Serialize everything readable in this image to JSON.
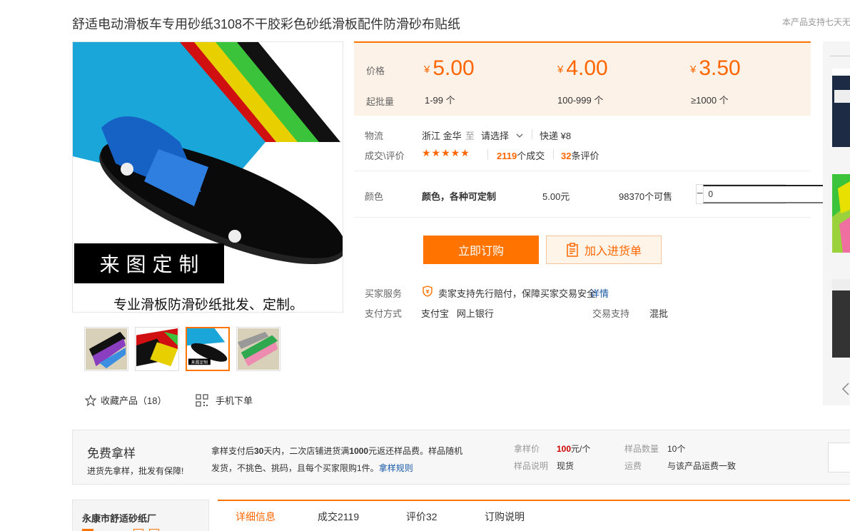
{
  "product": {
    "title": "舒适电动滑板车专用砂纸3108不干胶彩色砂纸滑板配件防滑砂布贴纸",
    "notice": "本产品支持七天无"
  },
  "gallery": {
    "banner_text": "来 图 定 制",
    "caption": "专业滑板防滑砂纸批发、定制。",
    "thumb_caption": "来图定制",
    "thumbnails": [
      "thumb-1",
      "thumb-2",
      "thumb-3",
      "thumb-4"
    ],
    "active_thumb": 3
  },
  "actions": {
    "favorite_label": "收藏产品（18）",
    "mobile_label": "手机下单"
  },
  "pricing": {
    "price_label": "价格",
    "moq_label": "起批量",
    "currency": "¥",
    "tiers": [
      {
        "price": "5.00",
        "range": "1-99 个"
      },
      {
        "price": "4.00",
        "range": "100-999 个"
      },
      {
        "price": "3.50",
        "range": "≥1000 个"
      }
    ]
  },
  "logistics": {
    "label": "物流",
    "from": "浙江 金华",
    "to_word": "至",
    "to_select": "请选择",
    "express": "快递 ¥8"
  },
  "reviews": {
    "label": "成交\\评价",
    "stars": "★★★★★",
    "deals_count": "2119",
    "deals_suffix": "个成交",
    "review_count": "32",
    "review_suffix": "条评价"
  },
  "sku": {
    "label": "颜色",
    "name": "颜色，各种可定制",
    "price": "5.00元",
    "stock": "98370个可售",
    "quantity": "0",
    "minus": "−",
    "plus": "+"
  },
  "buttons": {
    "buy": "立即订购",
    "cart": "加入进货单"
  },
  "service": {
    "label": "买家服务",
    "text": "卖家支持先行赔付，保障买家交易安全",
    "detail_link": "详情",
    "pay_label": "支付方式",
    "pay_methods": "支付宝   网上银行",
    "trade_label": "交易支持",
    "trade_value": "混批"
  },
  "sample": {
    "title": "免费拿样",
    "subtitle": "进货先拿样，批发有保障!",
    "desc_1": "拿样支付后",
    "desc_days": "30",
    "desc_2": "天内，二次店铺进货满",
    "desc_amount": "1000",
    "desc_3": "元返还样品费。样品随机发货，不挑色、挑码，且每个买家限购1件。",
    "rules_link": "拿样规则",
    "price_label": "拿样价",
    "price_value": "100",
    "price_unit": "元/个",
    "desc_label": "样品说明",
    "desc_value": "现货",
    "count_label": "样品数量",
    "count_value": "10个",
    "ship_label": "运费",
    "ship_value": "与该产品运费一致"
  },
  "shop": {
    "name": "永康市舒适砂纸厂"
  },
  "tabs": [
    {
      "label": "详细信息"
    },
    {
      "label": "成交2119"
    },
    {
      "label": "评价32"
    },
    {
      "label": "订购说明"
    }
  ],
  "colors": {
    "accent": "#ff7300",
    "price": "#ff6600",
    "link": "#1958a7",
    "panel_bg": "#fdf2e8"
  }
}
